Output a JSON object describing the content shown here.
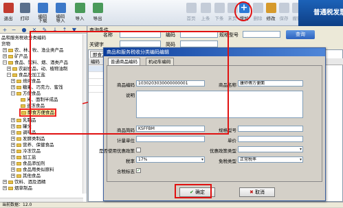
{
  "toolbar": {
    "exit": "退出",
    "print": "打印",
    "encode_download": "编码\n下载",
    "encode_import": "编码\n导入",
    "import": "导入",
    "export": "导出",
    "first": "首页",
    "prev": "上条",
    "next": "下条",
    "last": "末页",
    "add": "增加",
    "delete": "删除",
    "modify": "修改",
    "save": "保存",
    "cancel": "撤销",
    "brand": "普通税发票"
  },
  "tree": {
    "tool_icons": [
      "+",
      "−",
      "●",
      "✕",
      "✎",
      "↓",
      "↑",
      "▼"
    ],
    "items": [
      "品和服务税收分类编码",
      "货物",
      "农、林、牧、渔业类产品",
      "矿产品",
      "食品、饮料、烟、酒类产品",
      "农副食品，动、植物油制",
      "食品及加工盐",
      "焙烤食品",
      "糖果、巧克力、蜜饯",
      "方便食品",
      "米、面制半成品",
      "速冻食品",
      "即食方便食品",
      "乳制品",
      "罐头",
      "调味品",
      "发酵类制品",
      "营养、保健食品",
      "冷冻饮品",
      "加工盐",
      "食品添加剂",
      "食品用类似原料",
      "其他食品",
      "饮料、酒及酒精",
      "烟草制品"
    ]
  },
  "query": {
    "section": "查询条件",
    "name": "名称",
    "code": "编码",
    "spec": "规格型号",
    "keyword": "关键字",
    "short_code": "简码",
    "query_button": "查询"
  },
  "list": {
    "tab": "即食方便食品",
    "col_code": "编码"
  },
  "status": {
    "record_count": "当前数据：12.0"
  },
  "dialog": {
    "title": "商品和服务税收分类编码编辑",
    "tab_general": "普通商品编码",
    "tab_vehicle": "机动车编码",
    "labels": {
      "code": "商品编码",
      "name": "商品名称",
      "desc": "说明",
      "short": "商品简码",
      "spec": "规格型号",
      "unit": "计量单位",
      "price": "单价",
      "preferential": "是否使用优惠政策",
      "pref_type": "优惠政策类型",
      "tax_rate": "税率",
      "exempt_type": "免税类型",
      "tax_incl": "含税标志"
    },
    "values": {
      "code": "1030203030000000001",
      "name": "康师傅方便面",
      "short": "KSFFBM",
      "tax_rate": "17%",
      "exempt_type": "正常税率",
      "tax_incl_checked": "✓"
    },
    "ok_button": "确定",
    "cancel_button": "取消"
  }
}
